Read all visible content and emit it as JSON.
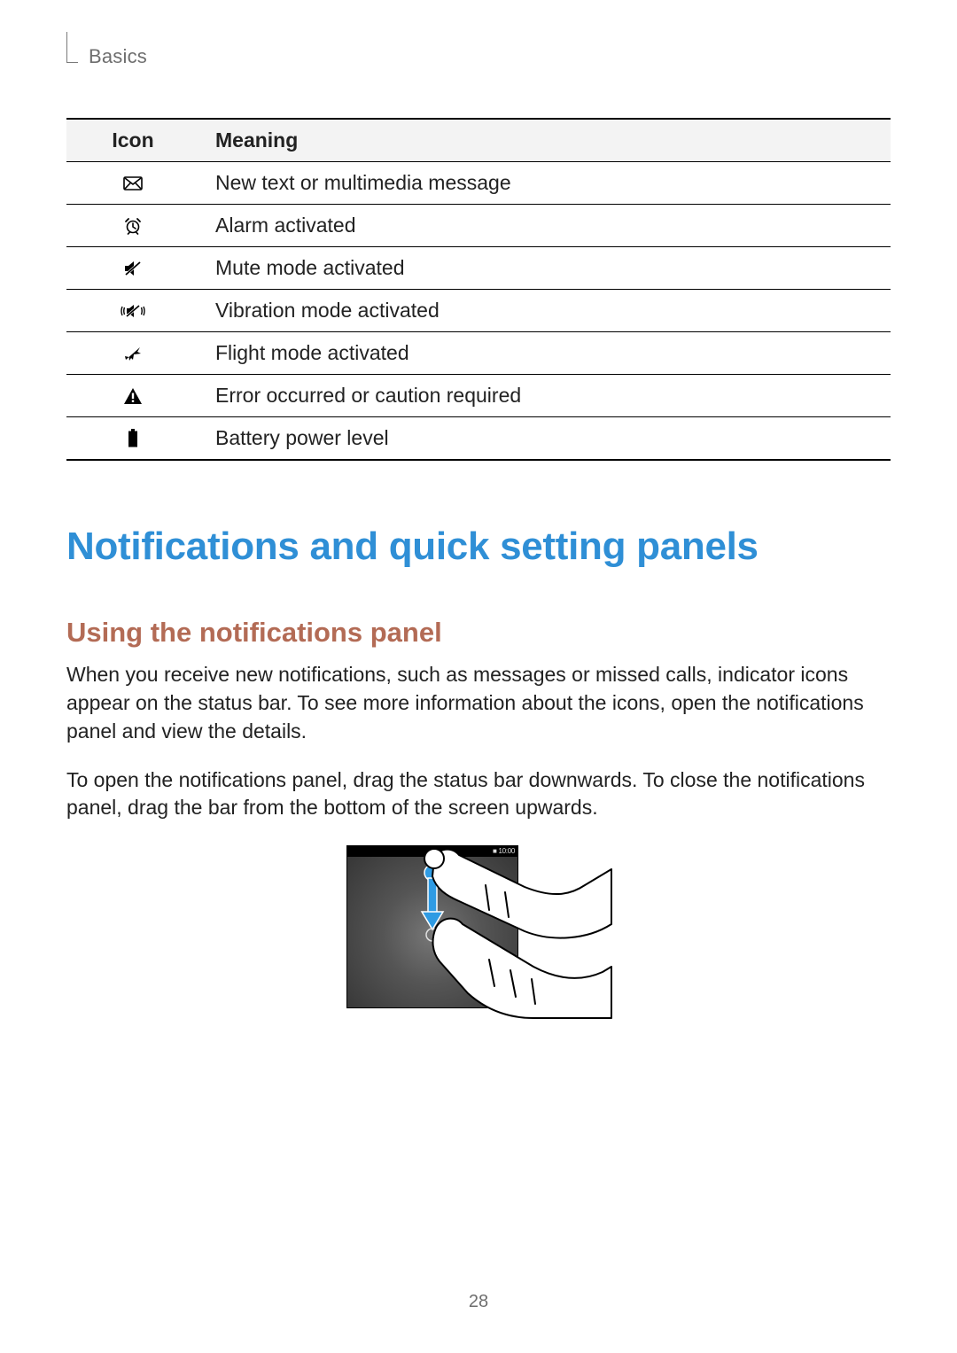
{
  "header": {
    "section": "Basics"
  },
  "table": {
    "headers": {
      "icon": "Icon",
      "meaning": "Meaning"
    },
    "rows": [
      {
        "icon_name": "message-icon",
        "meaning": "New text or multimedia message"
      },
      {
        "icon_name": "alarm-icon",
        "meaning": "Alarm activated"
      },
      {
        "icon_name": "mute-icon",
        "meaning": "Mute mode activated"
      },
      {
        "icon_name": "vibrate-icon",
        "meaning": "Vibration mode activated"
      },
      {
        "icon_name": "airplane-icon",
        "meaning": "Flight mode activated"
      },
      {
        "icon_name": "warning-icon",
        "meaning": "Error occurred or caution required"
      },
      {
        "icon_name": "battery-icon",
        "meaning": "Battery power level"
      }
    ]
  },
  "headings": {
    "h1": "Notifications and quick setting panels",
    "h2": "Using the notifications panel"
  },
  "paragraphs": {
    "p1": "When you receive new notifications, such as messages or missed calls, indicator icons appear on the status bar. To see more information about the icons, open the notifications panel and view the details.",
    "p2": "To open the notifications panel, drag the status bar downwards. To close the notifications panel, drag the bar from the bottom of the screen upwards."
  },
  "illustration": {
    "status_text": "■ 10:00"
  },
  "page_number": "28"
}
